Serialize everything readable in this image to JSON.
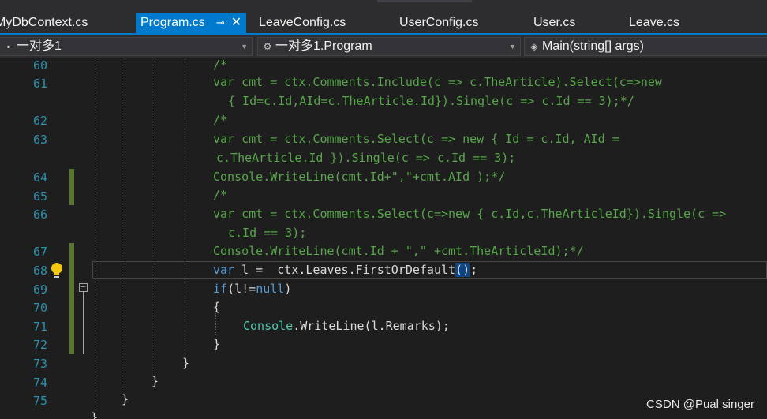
{
  "tabs": [
    {
      "label": "MyDbContext.cs",
      "active": false
    },
    {
      "label": "Program.cs",
      "active": true
    },
    {
      "label": "LeaveConfig.cs",
      "active": false
    },
    {
      "label": "UserConfig.cs",
      "active": false
    },
    {
      "label": "User.cs",
      "active": false
    },
    {
      "label": "Leave.cs",
      "active": false
    }
  ],
  "tab_icons": {
    "pin": "pin-icon",
    "close": "close-icon"
  },
  "nav": {
    "project": "一对多1",
    "class": "一对多1.Program",
    "member": "Main(string[] args)"
  },
  "line_numbers": [
    "60",
    "61",
    "62",
    "63",
    "64",
    "65",
    "66",
    "67",
    "68",
    "69",
    "70",
    "71",
    "72",
    "73",
    "74",
    "75"
  ],
  "code": {
    "l60": "/*",
    "l61a": "var cmt = ctx.Comments.Include(c => c.TheArticle).Select(c=>new",
    "l61b": "{ Id=c.Id,AId=c.TheArticle.Id}).Single(c => c.Id == 3);*/",
    "l62": "/*",
    "l63a": "var cmt = ctx.Comments.Select(c => new { Id = c.Id, AId =",
    "l63b": "c.TheArticle.Id }).Single(c => c.Id == 3);",
    "l64": "Console.WriteLine(cmt.Id+\",\"+cmt.AId );*/",
    "l65": "/*",
    "l66a": "var cmt = ctx.Comments.Select(c=>new { c.Id,c.TheArticleId}).Single(c =>",
    "l66b": "c.Id == 3);",
    "l67": "Console.WriteLine(cmt.Id + \",\" +cmt.TheArticleId);*/",
    "l68_kw": "var",
    "l68_rest": " l =  ctx.Leaves.FirstOrDefault",
    "l68_paren": "()",
    "l68_end": ";",
    "l69_kw": "if",
    "l69_mid": "(l!=",
    "l69_null": "null",
    "l69_end": ")",
    "l70": "{",
    "l71_type": "Console",
    "l71_rest": ".WriteLine(l.Remarks);",
    "l72": "}",
    "l73": "}",
    "l74": "}",
    "l75": "}"
  },
  "colors": {
    "accent": "#007acc",
    "comment": "#57a64a",
    "keyword": "#569cd6",
    "type": "#4ec9b0",
    "line_number": "#2b91af"
  },
  "watermark": "CSDN @Pual singer"
}
